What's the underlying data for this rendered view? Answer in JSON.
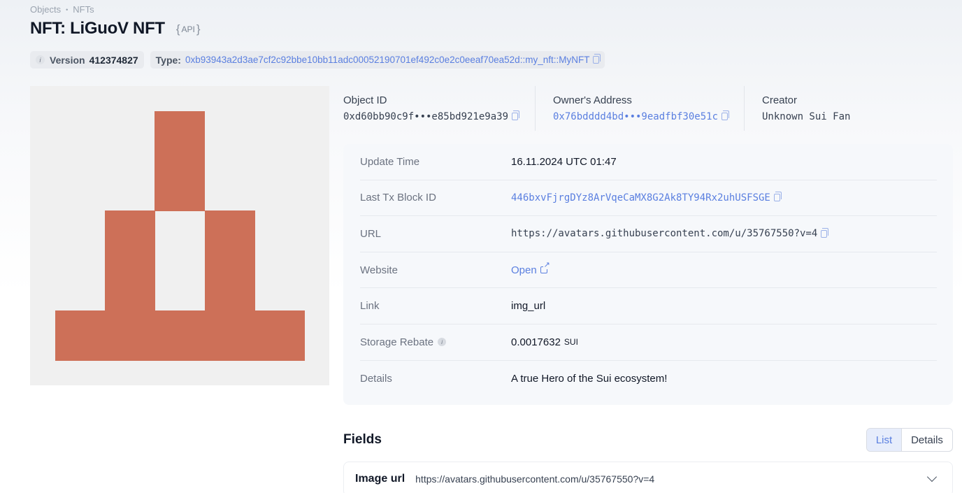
{
  "breadcrumb": {
    "objects": "Objects",
    "separator": "•",
    "nfts": "NFTs"
  },
  "page": {
    "title": "NFT: LiGuoV NFT",
    "api_label": "API",
    "api_open": "{",
    "api_close": "}"
  },
  "badges": {
    "version_icon": "i",
    "version_label": "Version",
    "version_value": "412374827",
    "type_label": "Type:",
    "type_value": "0xb93943a2d3ae7cf2c92bbe10bb11adc00052190701ef492c0e2c0eeaf70ea52d::my_nft::MyNFT"
  },
  "meta": {
    "object_id_label": "Object ID",
    "object_id_value": "0xd60bb90c9f•••e85bd921e9a39",
    "owner_label": "Owner's Address",
    "owner_value": "0x76bdddd4bd•••9eadfbf30e51c",
    "creator_label": "Creator",
    "creator_value": "Unknown Sui Fan"
  },
  "details": {
    "update_time_label": "Update Time",
    "update_time_value": "16.11.2024 UTC 01:47",
    "last_tx_label": "Last Tx Block ID",
    "last_tx_value": "446bxvFjrgDYz8ArVqeCaMX8G2Ak8TY94Rx2uhUSFSGE",
    "url_label": "URL",
    "url_value": "https://avatars.githubusercontent.com/u/35767550?v=4",
    "website_label": "Website",
    "website_value": "Open",
    "link_label": "Link",
    "link_value": "img_url",
    "storage_label": "Storage Rebate",
    "storage_icon": "i",
    "storage_value": "0.0017632",
    "storage_unit": "SUI",
    "details_label": "Details",
    "details_value": "A true Hero of the Sui ecosystem!"
  },
  "fields": {
    "title": "Fields",
    "toggle_list": "List",
    "toggle_details": "Details",
    "items": [
      {
        "name": "Image url",
        "value": "https://avatars.githubusercontent.com/u/35767550?v=4"
      }
    ]
  },
  "colors": {
    "accent": "#5a7fe0",
    "nft_block": "#cd7058",
    "nft_background": "#f0f0f0"
  },
  "icons": [
    "info-icon",
    "copy-icon",
    "external-link-icon",
    "chevron-down-icon"
  ]
}
